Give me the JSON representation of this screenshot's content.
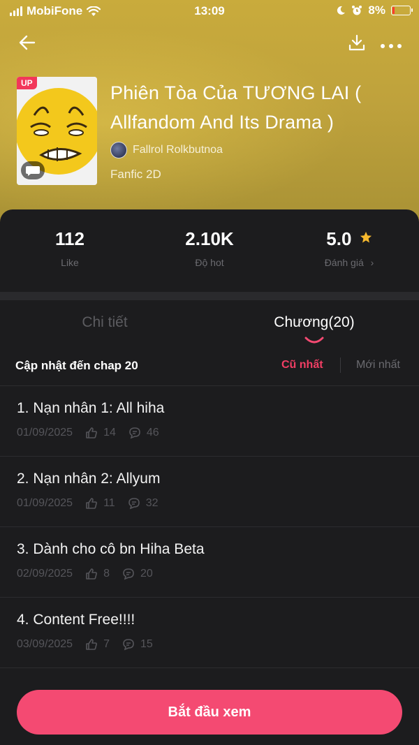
{
  "status_bar": {
    "carrier": "MobiFone",
    "time": "13:09",
    "battery": "8%"
  },
  "header": {
    "back_icon": "arrow-left-icon",
    "download_icon": "download-icon",
    "more_icon": "more-dots-icon"
  },
  "book": {
    "badge": "UP",
    "title": "Phiên Tòa Của TƯƠNG LAI ( Allfandom And Its Drama )",
    "author": "Fallrol Rolkbutnoa",
    "genre": "Fanfic 2D"
  },
  "stats": [
    {
      "value": "112",
      "label": "Like"
    },
    {
      "value": "2.10K",
      "label": "Độ hot"
    },
    {
      "value": "5.0",
      "label": "Đánh giá"
    }
  ],
  "tabs": [
    {
      "label": "Chi tiết",
      "active": false
    },
    {
      "label": "Chương(20)",
      "active": true
    }
  ],
  "filter": {
    "update_text": "Cập nhật đến chap 20",
    "oldest": "Cũ nhất",
    "newest": "Mới nhất"
  },
  "chapters": [
    {
      "title": "1. Nạn nhân 1: All hiha",
      "date": "01/09/2025",
      "likes": "14",
      "comments": "46"
    },
    {
      "title": "2. Nạn nhân 2: Allyum",
      "date": "01/09/2025",
      "likes": "11",
      "comments": "32"
    },
    {
      "title": "3. Dành cho cô bn Hiha Beta",
      "date": "02/09/2025",
      "likes": "8",
      "comments": "20"
    },
    {
      "title": "4. Content Free!!!!",
      "date": "03/09/2025",
      "likes": "7",
      "comments": "15"
    }
  ],
  "cta": {
    "label": "Bắt đầu xem"
  },
  "colors": {
    "accent": "#f44a72",
    "star": "#f5b82e",
    "hero": "#c9ab3c"
  }
}
